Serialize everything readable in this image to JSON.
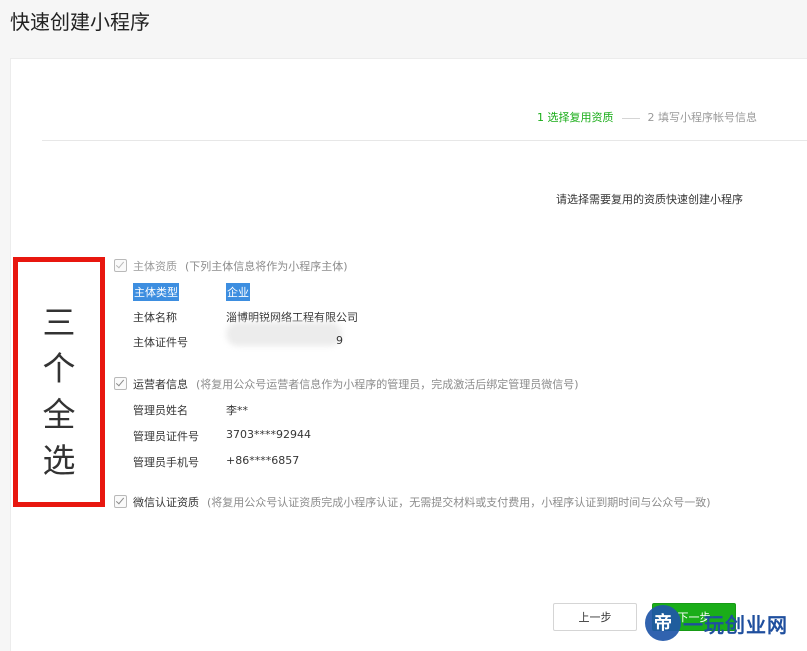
{
  "page": {
    "title": "快速创建小程序"
  },
  "steps": {
    "step1": "1 选择复用资质",
    "step2": "2 填写小程序帐号信息"
  },
  "hint": "请选择需要复用的资质快速创建小程序",
  "subject": {
    "heading": "主体资质",
    "note": "(下列主体信息将作为小程序主体)",
    "rows": [
      {
        "label": "主体类型",
        "value": "企业"
      },
      {
        "label": "主体名称",
        "value": "淄博明锐网络工程有限公司"
      },
      {
        "label": "主体证件号",
        "value_tail": "9"
      }
    ]
  },
  "operator": {
    "heading": "运营者信息",
    "note": "(将复用公众号运营者信息作为小程序的管理员，完成激活后绑定管理员微信号)",
    "rows": [
      {
        "label": "管理员姓名",
        "value": "李**"
      },
      {
        "label": "管理员证件号",
        "value": "3703****92944"
      },
      {
        "label": "管理员手机号",
        "value": "+86****6857"
      }
    ]
  },
  "wechat_cert": {
    "heading": "微信认证资质",
    "note": "(将复用公众号认证资质完成小程序认证，无需提交材料或支付费用，小程序认证到期时间与公众号一致)"
  },
  "annotation": {
    "text": "三个全选",
    "color": "#e8170f"
  },
  "buttons": {
    "prev": "上一步",
    "next": "下一步"
  },
  "watermark": {
    "logo": "帝",
    "text": "一玩创业网"
  },
  "colors": {
    "accent": "#1aad19",
    "selection": "#3d8ee0"
  }
}
